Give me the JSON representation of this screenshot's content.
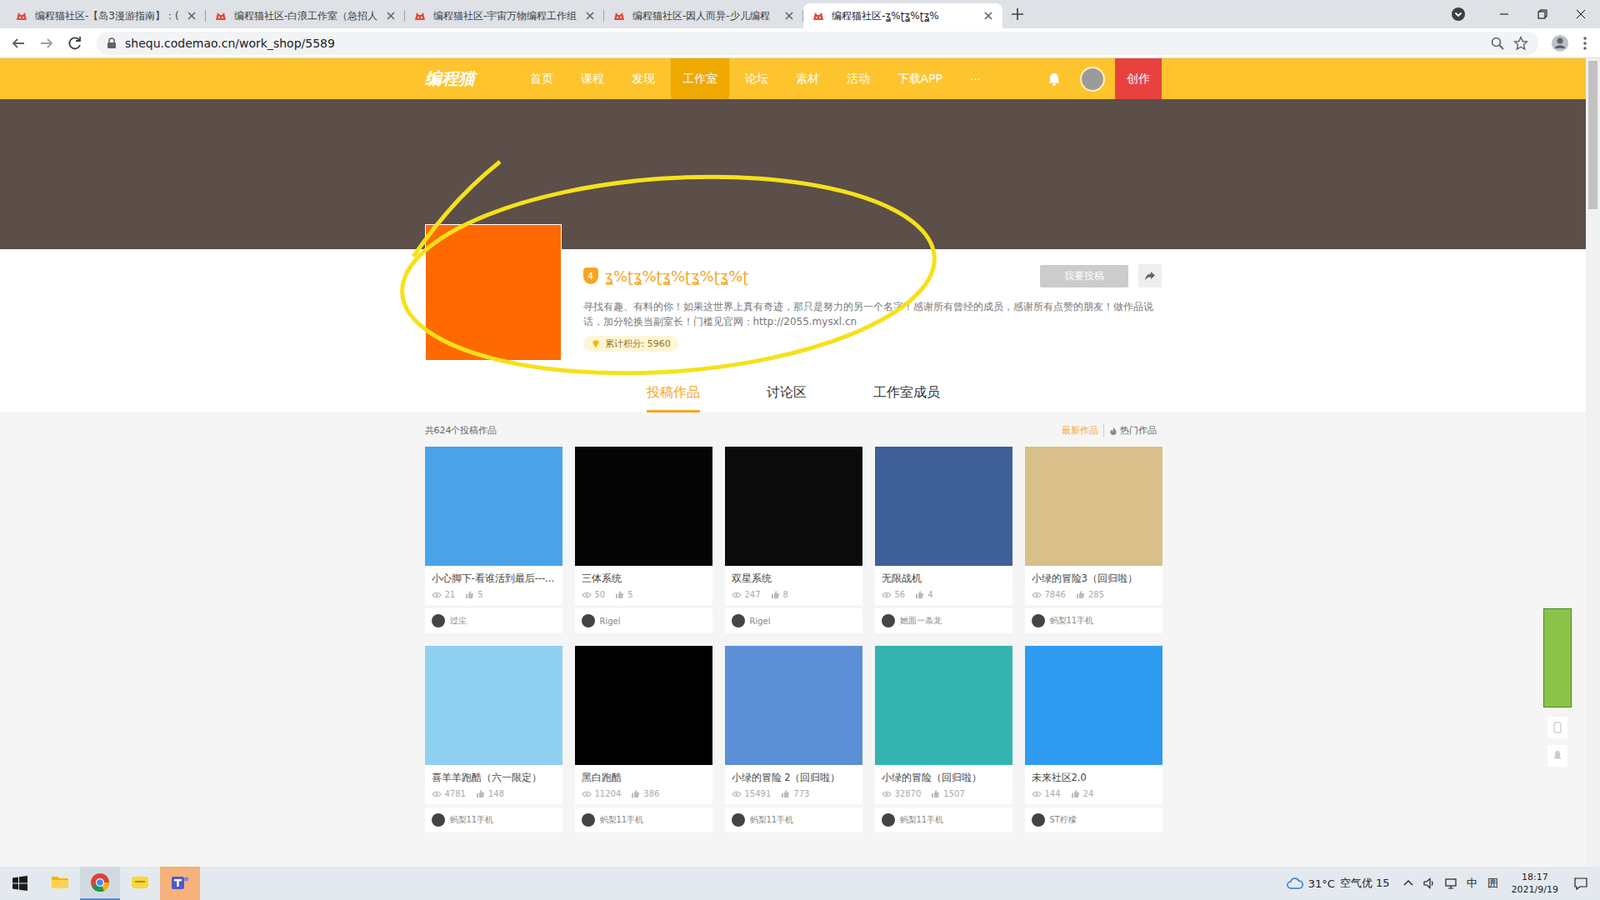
{
  "browser": {
    "tabs": [
      {
        "title": "编程猫社区-【岛3漫游指南】：(",
        "selected": false
      },
      {
        "title": "编程猫社区-白浪工作室（急招人",
        "selected": false
      },
      {
        "title": "编程猫社区-宇宙万物编程工作组",
        "selected": false
      },
      {
        "title": "编程猫社区-因人而异-少儿编程",
        "selected": false
      },
      {
        "title": "编程猫社区-ʓ%ʈʓ%ʈʓ%",
        "selected": true
      }
    ],
    "url": "shequ.codemao.cn/work_shop/5589"
  },
  "site_nav": {
    "logo": "编程猫",
    "items": [
      {
        "label": "首页",
        "selected": false
      },
      {
        "label": "课程",
        "selected": false
      },
      {
        "label": "发现",
        "selected": false
      },
      {
        "label": "工作室",
        "selected": true
      },
      {
        "label": "论坛",
        "selected": false
      },
      {
        "label": "素材",
        "selected": false
      },
      {
        "label": "活动",
        "selected": false
      },
      {
        "label": "下载APP",
        "selected": false
      },
      {
        "label": "···",
        "selected": false
      }
    ],
    "create": "创作"
  },
  "studio": {
    "level": "4",
    "name": "ʓ%ʈʓ%ʈʓ%ʈʓ%ʈʓ%ʈ",
    "description": "寻找有趣、有料的你！如果这世界上真有奇迹，那只是努力的另一个名字！感谢所有曾经的成员，感谢所有点赞的朋友！做作品说话，加分轮换当副室长！门槛见官网：http://2055.mysxl.cn",
    "score": "累计积分: 5960",
    "submit": "我要投稿"
  },
  "tabs": [
    {
      "label": "投稿作品",
      "selected": true
    },
    {
      "label": "讨论区",
      "selected": false
    },
    {
      "label": "工作室成员",
      "selected": false
    }
  ],
  "works": {
    "count": "共624个投稿作品",
    "sort": [
      {
        "label": "最新作品",
        "selected": true,
        "kind": "latest"
      },
      {
        "label": "热门作品",
        "selected": false,
        "kind": "hot"
      }
    ],
    "items": [
      {
        "title": "小心脚下-看谁活到最后---...",
        "views": "21",
        "likes": "5",
        "author": "过尘",
        "color": "#4aa3e8"
      },
      {
        "title": "三体系统",
        "views": "50",
        "likes": "5",
        "author": "Rigel",
        "color": "#050505"
      },
      {
        "title": "双星系统",
        "views": "247",
        "likes": "8",
        "author": "Rigel",
        "color": "#0b0b0b"
      },
      {
        "title": "无限战机",
        "views": "56",
        "likes": "4",
        "author": "她面一条龙",
        "color": "#3f5f99"
      },
      {
        "title": "小绿的冒险3（回归啦）",
        "views": "7846",
        "likes": "285",
        "author": "蚂梨11手机",
        "color": "#d9c08a"
      },
      {
        "title": "喜羊羊跑酷（六一限定）",
        "views": "4781",
        "likes": "148",
        "author": "蚂梨11手机",
        "color": "#8fd0f0"
      },
      {
        "title": "黑白跑酷",
        "views": "11204",
        "likes": "386",
        "author": "蚂梨11手机",
        "color": "#000000"
      },
      {
        "title": "小绿的冒险 2（回归啦）",
        "views": "15491",
        "likes": "773",
        "author": "蚂梨11手机",
        "color": "#5b8fd6"
      },
      {
        "title": "小绿的冒险（回归啦）",
        "views": "32870",
        "likes": "1507",
        "author": "蚂梨11手机",
        "color": "#34b3b0"
      },
      {
        "title": "未来社区2.0",
        "views": "144",
        "likes": "24",
        "author": "ST柠檬",
        "color": "#2f9bf0"
      }
    ]
  },
  "taskbar": {
    "apps": [
      {
        "kind": "explorer",
        "active": false,
        "flashing": false
      },
      {
        "kind": "chrome",
        "active": true,
        "flashing": false
      },
      {
        "kind": "notes",
        "active": false,
        "flashing": false
      },
      {
        "kind": "teams",
        "active": false,
        "flashing": true
      }
    ],
    "weather": "31°C",
    "air": "空气优 15",
    "ime": "中",
    "ime_mode": "囲",
    "time": "18:17",
    "date": "2021/9/19"
  }
}
